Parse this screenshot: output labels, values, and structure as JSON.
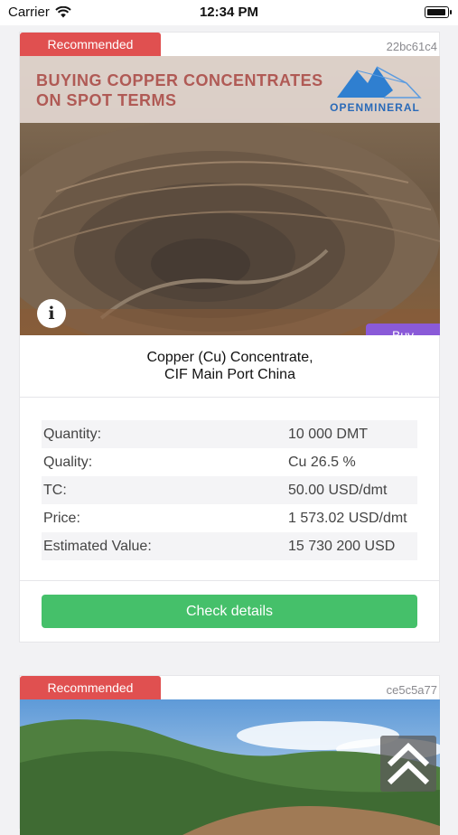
{
  "status_bar": {
    "carrier": "Carrier",
    "time": "12:34 PM"
  },
  "offers": [
    {
      "badge": "Recommended",
      "id": "22bc61c4",
      "banner_headline_line1": "BUYING COPPER CONCENTRATES",
      "banner_headline_line2": "ON SPOT TERMS",
      "logo_text": "OPENMINERAL",
      "buy_label": "Buy",
      "info_label": "i",
      "product_line1": "Copper (Cu) Concentrate,",
      "product_line2": "CIF Main Port China",
      "specs": [
        {
          "label": "Quantity:",
          "value": "10 000 DMT"
        },
        {
          "label": "Quality:",
          "value": "Cu 26.5 %"
        },
        {
          "label": "TC:",
          "value": "50.00 USD/dmt"
        },
        {
          "label": "Price:",
          "value": "1 573.02 USD/dmt"
        },
        {
          "label": "Estimated Value:",
          "value": "15 730 200 USD"
        }
      ],
      "cta_label": "Check details"
    },
    {
      "badge": "Recommended",
      "id": "ce5c5a77"
    }
  ],
  "colors": {
    "badge": "#e05050",
    "buy": "#8a5ad8",
    "cta": "#45c06a",
    "headline": "#b05a55"
  }
}
